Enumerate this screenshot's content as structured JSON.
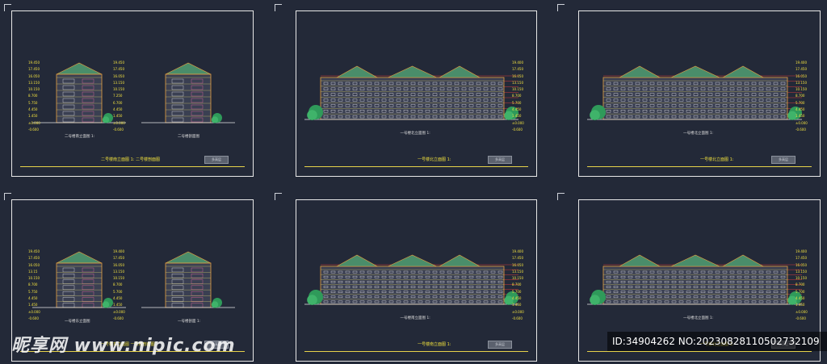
{
  "sheets": [
    {
      "kind": "side",
      "captions": [
        "二号楼南立面图 1:",
        "二号楼剖面图"
      ],
      "title": "二号楼南立面图 1:    二号楼剖面图",
      "ticks_left": [
        "19.450",
        "17.450",
        "16.050",
        "13.150",
        "10.150",
        "8.700",
        "5.750",
        "4.450",
        "1.450",
        "±0.000",
        "-0.600"
      ],
      "ticks_right": [
        "19.450",
        "17.450",
        "16.050",
        "13.150",
        "10.150",
        "7.250",
        "6.700",
        "4.450",
        "1.450",
        "±0.000",
        "-0.600"
      ]
    },
    {
      "kind": "long",
      "captions": [
        "一号楼北立面图 1:"
      ],
      "title": "一号楼北立面图 1:",
      "ticks_right": [
        "19.400",
        "17.450",
        "16.050",
        "13.150",
        "10.150",
        "8.700",
        "5.700",
        "4.450",
        "1.450",
        "±0.000",
        "-0.600"
      ]
    },
    {
      "kind": "long",
      "captions": [
        "一号楼北立面图 1:"
      ],
      "title": "一号楼北立面图 1:",
      "ticks_right": [
        "19.400",
        "17.450",
        "16.050",
        "13.150",
        "10.150",
        "8.700",
        "5.700",
        "4.450",
        "1.450",
        "±0.000",
        "-0.600"
      ]
    },
    {
      "kind": "side",
      "captions": [
        "一号楼东立面图",
        "一号楼剖面 1:"
      ],
      "title": "一号楼东立面图    一号楼剖面图",
      "ticks_left": [
        "19.450",
        "17.450",
        "16.050",
        "13.15",
        "10.150",
        "8.700",
        "5.750",
        "4.450",
        "1.450",
        "±0.000",
        "-0.600"
      ],
      "ticks_right": [
        "19.400",
        "17.450",
        "16.050",
        "13.150",
        "10.150",
        "8.700",
        "5.700",
        "4.450",
        "1.450",
        "±0.000",
        "-0.600"
      ]
    },
    {
      "kind": "long",
      "captions": [
        "一号楼南立面图 1:"
      ],
      "title": "一号楼南立面图 1:",
      "ticks_right": [
        "19.400",
        "17.450",
        "16.050",
        "13.150",
        "10.150",
        "8.700",
        "5.700",
        "4.450",
        "1.450",
        "±0.000",
        "-0.600"
      ]
    },
    {
      "kind": "long",
      "captions": [
        "一号楼北立面图 1:"
      ],
      "title": "一号楼北立面图 1:",
      "ticks_right": [
        "19.400",
        "17.450",
        "16.050",
        "13.150",
        "10.150",
        "8.700",
        "5.700",
        "4.450",
        "1.450",
        "±0.000",
        "-0.600"
      ]
    }
  ],
  "stamp_label": "多高层",
  "watermark": "昵享网 www.nipic.com",
  "id_text": "ID:34904262 NO:20230828110502732109",
  "colors": {
    "bg": "#232938",
    "frame": "#e8e8e8",
    "yellow": "#f2e23c",
    "red": "#d23a3a",
    "green": "#3fb36a",
    "orange": "#e8a040"
  }
}
